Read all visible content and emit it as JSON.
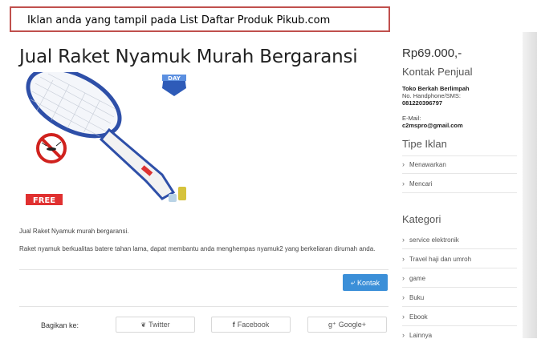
{
  "banner": {
    "text": "Iklan anda yang tampil pada List Daftar Produk Pikub.com"
  },
  "product": {
    "title": "Jual Raket Nyamuk Murah Bergaransi",
    "image_badge": "DAY",
    "image_free_label": "FREE",
    "description_short": "Jual Raket Nyamuk murah bergaransi.",
    "description_long": "Raket nyamuk berkualitas batere tahan lama, dapat membantu anda menghempas nyamuk2 yang berkeliaran dirumah anda.",
    "contact_button": "Kontak"
  },
  "share": {
    "label": "Bagikan ke:",
    "buttons": [
      {
        "label": "Twitter",
        "icon": "twitter-icon"
      },
      {
        "label": "Facebook",
        "icon": "facebook-icon"
      },
      {
        "label": "Google+",
        "icon": "google-plus-icon"
      }
    ]
  },
  "sidebar": {
    "price": "Rp69.000,-",
    "contact_title": "Kontak Penjual",
    "seller_name": "Toko Berkah Berlimpah",
    "phone_label": "No. Handphone/SMS:",
    "phone": "081220396797",
    "email_label": "E-Mail:",
    "email": "c2mspro@gmail.com",
    "ad_type_title": "Tipe Iklan",
    "ad_types": [
      "Menawarkan",
      "Mencari"
    ],
    "category_title": "Kategori",
    "categories": [
      "service elektronik",
      "Travel haji dan umroh",
      "game",
      "Buku",
      "Ebook",
      "Lainnya"
    ]
  },
  "colors": {
    "accent": "#3b8fd8",
    "banner_border": "#c0504d"
  }
}
